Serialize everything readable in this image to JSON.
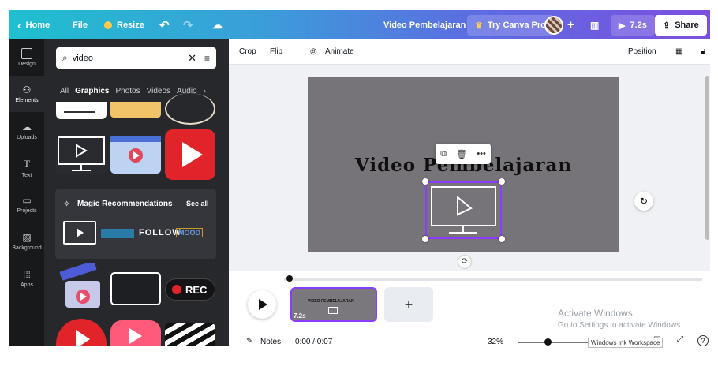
{
  "topbar": {
    "home_label": "Home",
    "file_label": "File",
    "resize_label": "Resize",
    "doc_title": "Video Pembelajaran",
    "try_pro_label": "Try Canva Pro",
    "duration_label": "7.2s",
    "share_label": "Share"
  },
  "rail": {
    "items": [
      {
        "label": "Design",
        "icon": "design-icon"
      },
      {
        "label": "Elements",
        "icon": "elements-icon"
      },
      {
        "label": "Uploads",
        "icon": "upload-icon"
      },
      {
        "label": "Text",
        "icon": "text-icon"
      },
      {
        "label": "Projects",
        "icon": "folder-icon"
      },
      {
        "label": "Background",
        "icon": "background-icon"
      },
      {
        "label": "Apps",
        "icon": "apps-icon"
      }
    ]
  },
  "panel": {
    "search_value": "video",
    "tabs": [
      "All",
      "Graphics",
      "Photos",
      "Videos",
      "Audio"
    ],
    "active_tab": "Graphics",
    "magic_title": "Magic Recommendations",
    "see_all": "See all",
    "magic_items": [
      "FOLLOW",
      "MOOD"
    ],
    "rec_label": "REC"
  },
  "toolbar": {
    "crop": "Crop",
    "flip": "Flip",
    "animate": "Animate",
    "position": "Position"
  },
  "canvas": {
    "headline": "Video Pembelajaran",
    "bg_color": "#767478"
  },
  "timeline": {
    "clip_duration": "7.2s",
    "clip_title": "VIDEO PEMBELAJARAN"
  },
  "bottom": {
    "notes": "Notes",
    "time": "0:00 / 0:07",
    "zoom": "32%"
  },
  "overlay": {
    "activate_title": "Activate Windows",
    "activate_sub": "Go to Settings to activate Windows.",
    "ink_tooltip": "Windows Ink Workspace"
  },
  "colors": {
    "accent": "#8b3dff",
    "brand_start": "#1fbfcf",
    "brand_end": "#7b4fe0"
  }
}
